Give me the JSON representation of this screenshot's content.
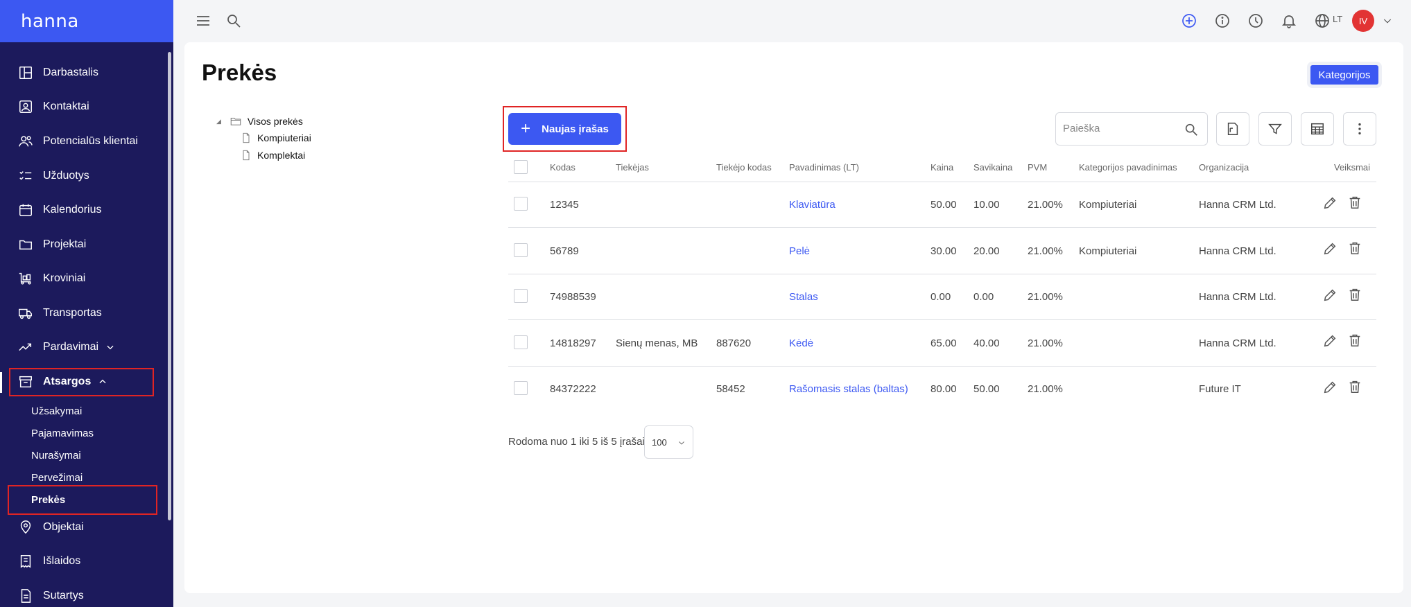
{
  "brand": "hanna",
  "sidebar": {
    "items": [
      {
        "label": "Darbastalis",
        "icon": "dashboard-icon"
      },
      {
        "label": "Kontaktai",
        "icon": "contacts-icon"
      },
      {
        "label": "Potencialūs klientai",
        "icon": "leads-icon"
      },
      {
        "label": "Užduotys",
        "icon": "tasks-icon"
      },
      {
        "label": "Kalendorius",
        "icon": "calendar-icon"
      },
      {
        "label": "Projektai",
        "icon": "folder-icon"
      },
      {
        "label": "Kroviniai",
        "icon": "cargo-icon"
      },
      {
        "label": "Transportas",
        "icon": "truck-icon"
      },
      {
        "label": "Pardavimai",
        "icon": "sales-trend-icon"
      },
      {
        "label": "Atsargos",
        "icon": "inventory-icon"
      },
      {
        "label": "Objektai",
        "icon": "location-pin-icon"
      },
      {
        "label": "Išlaidos",
        "icon": "expenses-icon"
      },
      {
        "label": "Sutartys",
        "icon": "contract-icon"
      }
    ],
    "subitems": [
      "Užsakymai",
      "Pajamavimas",
      "Nurašymai",
      "Pervežimai",
      "Prekės"
    ]
  },
  "topbar": {
    "lang": "LT",
    "avatar": "IV"
  },
  "page": {
    "title": "Prekės",
    "categories_button": "Kategorijos"
  },
  "tree": {
    "root": "Visos prekės",
    "children": [
      "Kompiuteriai",
      "Komplektai"
    ]
  },
  "toolbar": {
    "new_button": "Naujas įrašas",
    "search_placeholder": "Paieška"
  },
  "table": {
    "headers": [
      "Kodas",
      "Tiekėjas",
      "Tiekėjo kodas",
      "Pavadinimas (LT)",
      "Kaina",
      "Savikaina",
      "PVM",
      "Kategorijos pavadinimas",
      "Organizacija",
      "Veiksmai"
    ],
    "rows": [
      {
        "code": "12345",
        "supplier": "",
        "supplier_code": "",
        "name": "Klaviatūra",
        "price": "50.00",
        "cost": "10.00",
        "vat": "21.00%",
        "category": "Kompiuteriai",
        "org": "Hanna CRM Ltd."
      },
      {
        "code": "56789",
        "supplier": "",
        "supplier_code": "",
        "name": "Pelė",
        "price": "30.00",
        "cost": "20.00",
        "vat": "21.00%",
        "category": "Kompiuteriai",
        "org": "Hanna CRM Ltd."
      },
      {
        "code": "74988539",
        "supplier": "",
        "supplier_code": "",
        "name": "Stalas",
        "price": "0.00",
        "cost": "0.00",
        "vat": "21.00%",
        "category": "",
        "org": "Hanna CRM Ltd."
      },
      {
        "code": "14818297",
        "supplier": "Sienų menas, MB",
        "supplier_code": "887620",
        "name": "Kėdė",
        "price": "65.00",
        "cost": "40.00",
        "vat": "21.00%",
        "category": "",
        "org": "Hanna CRM Ltd."
      },
      {
        "code": "84372222",
        "supplier": "",
        "supplier_code": "58452",
        "name": "Rašomasis stalas (baltas)",
        "price": "80.00",
        "cost": "50.00",
        "vat": "21.00%",
        "category": "",
        "org": "Future IT"
      }
    ]
  },
  "footer": {
    "summary": "Rodoma nuo 1 iki 5 iš 5 įrašai",
    "page_size": "100"
  },
  "colors": {
    "primary": "#3c58f2",
    "sidebar_bg": "#1c1a5c",
    "highlight": "#e02424",
    "avatar": "#e23434"
  }
}
